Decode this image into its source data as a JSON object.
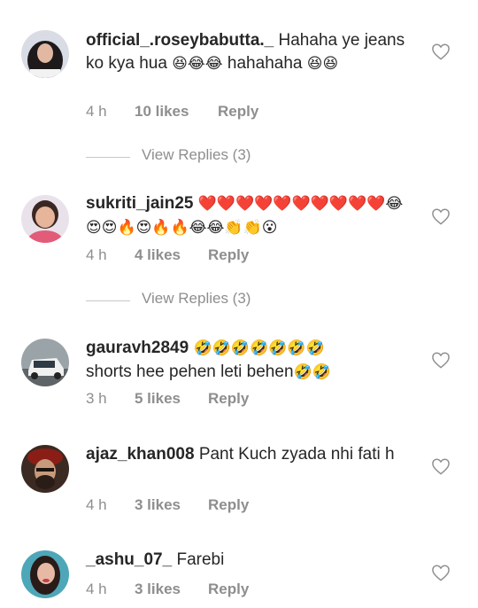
{
  "comments": [
    {
      "username": "official_.roseybabutta._",
      "text": "Hahaha ye jeans ko kya hua",
      "emoji": "😆😂😂",
      "text2": "hahahaha",
      "emoji2": "😆😆",
      "time": "4 h",
      "likes": "10 likes",
      "reply": "Reply"
    },
    {
      "username": "sukriti_jain25",
      "emoji": "❤️❤️❤️❤️❤️❤️❤️❤️❤️❤️😂😍😍🔥😍🔥🔥😂😂👏👏😮",
      "time": "4 h",
      "likes": "4 likes",
      "reply": "Reply"
    },
    {
      "username": "gauravh2849",
      "emoji": "🤣🤣🤣🤣🤣🤣🤣",
      "text": "shorts hee pehen leti behen",
      "emoji2": "🤣🤣",
      "time": "3 h",
      "likes": "5 likes",
      "reply": "Reply"
    },
    {
      "username": "ajaz_khan008",
      "text": "Pant Kuch zyada nhi fati h",
      "time": "4 h",
      "likes": "3 likes",
      "reply": "Reply"
    },
    {
      "username": "_ashu_07_",
      "text": "Farebi",
      "time": "4 h",
      "likes": "3 likes",
      "reply": "Reply"
    }
  ],
  "view_replies": [
    "View Replies (3)",
    "View Replies (3)"
  ],
  "colors": {
    "meta": "#8e8e8e",
    "text": "#262626",
    "divider": "#c7c7c7"
  },
  "icons": {
    "like": "heart-outline-icon"
  }
}
